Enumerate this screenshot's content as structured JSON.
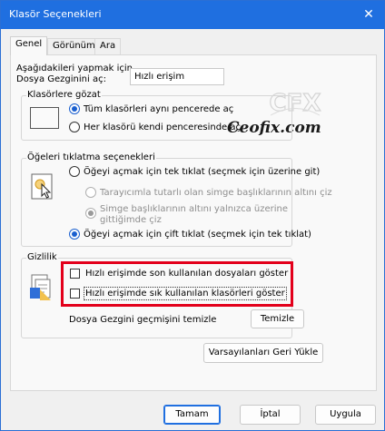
{
  "window": {
    "title": "Klasör Seçenekleri"
  },
  "tabs": [
    "Genel",
    "Görünüm",
    "Ara"
  ],
  "intro": {
    "line1": "Aşağıdakileri yapmak için",
    "line2": "Dosya Gezginini aç:",
    "select_value": "Hızlı erişim"
  },
  "watermark": {
    "brand": "Ceofix.com"
  },
  "browse": {
    "title": "Klasörlere gözat",
    "options": [
      "Tüm klasörleri aynı pencerede aç",
      "Her klasörü kendi penceresinde aç"
    ]
  },
  "click": {
    "title": "Öğeleri tıklatma seçenekleri",
    "single": "Öğeyi açmak için tek tıklat (seçmek için üzerine git)",
    "sub1": "Tarayıcımla tutarlı olan simge başlıklarının altını çiz",
    "sub2_line1": "Simge başlıklarının altını yalnızca üzerine",
    "sub2_line2": "gittiğimde çiz",
    "double": "Öğeyi açmak için çift tıklat (seçmek için tek tıklat)"
  },
  "privacy": {
    "title": "Gizlilik",
    "recent_files": "Hızlı erişimde son kullanılan dosyaları göster",
    "frequent_folders": "Hızlı erişimde sık kullanılan klasörleri göster",
    "clear_label": "Dosya Gezgini geçmişini temizle",
    "clear_button": "Temizle"
  },
  "restore_defaults": "Varsayılanları Geri Yükle",
  "footer": {
    "ok": "Tamam",
    "cancel": "İptal",
    "apply": "Uygula"
  },
  "colors": {
    "titlebar": "#1f6fe0",
    "accent": "#1a5fcf",
    "highlight": "#e3001b"
  }
}
